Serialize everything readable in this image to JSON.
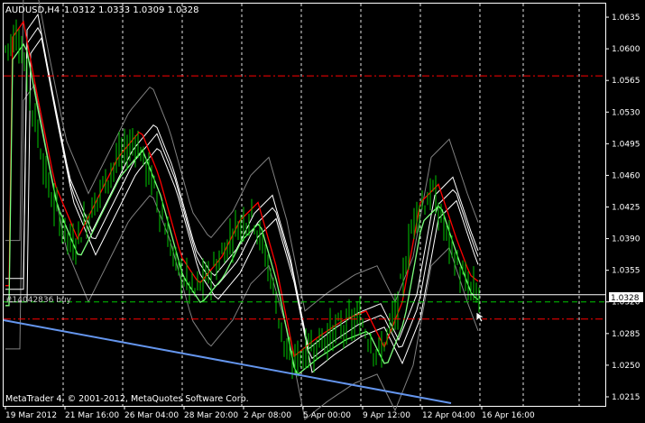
{
  "header": {
    "symbol_label": "AUDUSD,H4",
    "ohlc": "1.0312 1.0333 1.0309 1.0328"
  },
  "footer": {
    "copyright": "MetaTrader 4, © 2001-2012, MetaQuotes Software Corp."
  },
  "order_label": "#14042836 buy",
  "current_price_tag": "1.0328",
  "colors": {
    "background": "#000000",
    "axis": "#ffffff",
    "grid": "#ffffff",
    "candles": "#00c800",
    "ma_red": "#ff0000",
    "ma_green": "#7cff7c",
    "envelopes": "#ffffff",
    "bollinger": "#808080",
    "trendline": "#6495ed",
    "level_red": "#ff0000",
    "level_green": "#00c800"
  },
  "chart_data": {
    "type": "candlestick",
    "symbol": "AUDUSD",
    "timeframe": "H4",
    "price_axis_ticks": [
      "1.0635",
      "1.0600",
      "1.0565",
      "1.0530",
      "1.0495",
      "1.0460",
      "1.0425",
      "1.0390",
      "1.0355",
      "1.0320",
      "1.0285",
      "1.0250",
      "1.0215"
    ],
    "time_axis_labels": [
      "19 Mar 2012",
      "21 Mar 16:00",
      "26 Mar 04:00",
      "28 Mar 20:00",
      "2 Apr 08:00",
      "5 Apr 00:00",
      "9 Apr 12:00",
      "12 Apr 04:00",
      "16 Apr 16:00"
    ],
    "ohlc_last": {
      "open": 1.0312,
      "high": 1.0333,
      "low": 1.0309,
      "close": 1.0328
    },
    "levels": [
      {
        "price": 1.057,
        "style": "dash-dot",
        "color": "red"
      },
      {
        "price": 1.032,
        "style": "dashed",
        "color": "green",
        "label": "#14042836 buy"
      },
      {
        "price": 1.0328,
        "style": "solid",
        "color": "white",
        "label": "1.0328"
      },
      {
        "price": 1.0301,
        "style": "dash-dot",
        "color": "red"
      }
    ],
    "ylim": [
      1.0205,
      1.065
    ],
    "grid": true
  }
}
